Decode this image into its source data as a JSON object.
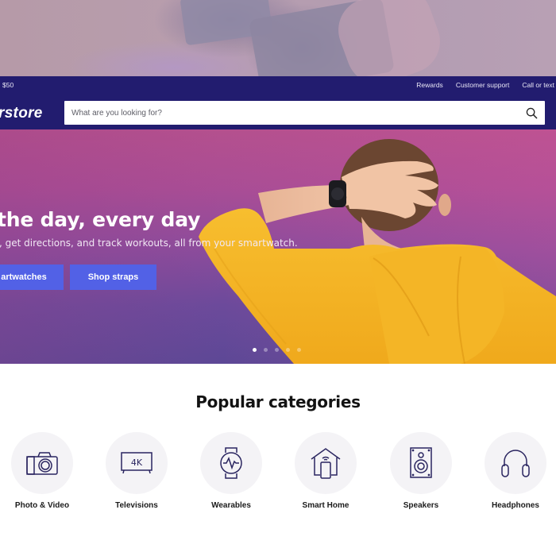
{
  "backdrop": {
    "description": "blurred-photo"
  },
  "navbar": {
    "promo_text": "$50",
    "utility_links": [
      "Rewards",
      "Customer support",
      "Call or text"
    ],
    "logo_text": "rstore",
    "search": {
      "placeholder": "What are you looking for?",
      "value": "",
      "icon": "search-icon"
    }
  },
  "hero": {
    "title": "the day, every day",
    "subtitle": ", get directions, and track workouts, all from your smartwatch.",
    "buttons": [
      {
        "label": "artwatches"
      },
      {
        "label": "Shop straps"
      }
    ],
    "carousel": {
      "total_slides": 5,
      "active_index": 0
    },
    "colors": {
      "button": "#5261e6",
      "navbar": "#221c6f"
    }
  },
  "categories": {
    "title": "Popular categories",
    "items": [
      {
        "label": "Photo & Video",
        "icon": "camera-icon"
      },
      {
        "label": "Televisions",
        "icon": "tv-4k-icon"
      },
      {
        "label": "Wearables",
        "icon": "smartwatch-icon"
      },
      {
        "label": "Smart Home",
        "icon": "smart-home-icon"
      },
      {
        "label": "Speakers",
        "icon": "speaker-icon"
      },
      {
        "label": "Headphones",
        "icon": "headphones-icon"
      }
    ]
  }
}
